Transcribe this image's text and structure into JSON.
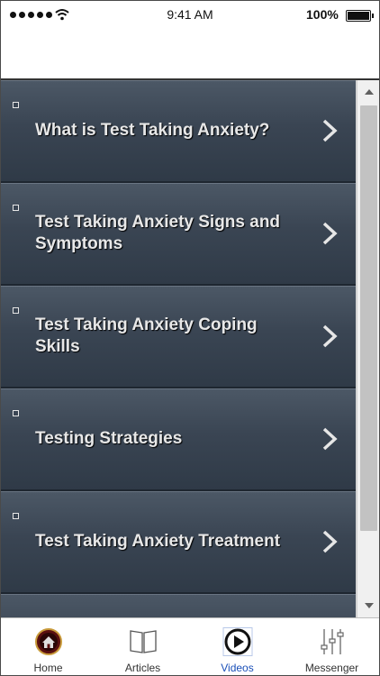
{
  "status_bar": {
    "time": "9:41 AM",
    "battery": "100%",
    "icons": [
      "signal-icon",
      "wifi-icon",
      "battery-icon"
    ]
  },
  "list": {
    "items": [
      {
        "label": "What is Test Taking Anxiety?"
      },
      {
        "label": "Test Taking Anxiety Signs and Symptoms"
      },
      {
        "label": "Test Taking Anxiety Coping Skills"
      },
      {
        "label": "Testing Strategies"
      },
      {
        "label": "Test Taking Anxiety Treatment"
      },
      {
        "label": ""
      }
    ]
  },
  "tabbar": {
    "tabs": [
      {
        "label": "Home",
        "icon": "home-icon"
      },
      {
        "label": "Articles",
        "icon": "book-icon"
      },
      {
        "label": "Videos",
        "icon": "play-icon",
        "active": true
      },
      {
        "label": "Messenger",
        "icon": "sliders-icon"
      }
    ]
  },
  "colors": {
    "list_bg": "#3a4553",
    "active_tab": "#1a4fb8"
  }
}
